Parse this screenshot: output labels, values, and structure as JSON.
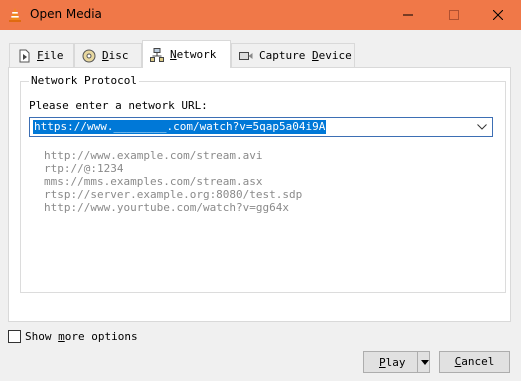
{
  "window": {
    "title": "Open Media",
    "icon": "vlc-cone-icon"
  },
  "tabs": [
    {
      "label": "File",
      "icon": "file-icon"
    },
    {
      "label": "Disc",
      "icon": "disc-icon"
    },
    {
      "label": "Network",
      "icon": "network-icon",
      "active": true
    },
    {
      "label": "Capture Device",
      "icon": "capture-device-icon"
    }
  ],
  "network": {
    "group_title": "Network Protocol",
    "url_label": "Please enter a network URL:",
    "url_value": "https://www.________.com/watch?v=5qap5a04i9A",
    "examples": [
      "http://www.example.com/stream.avi",
      "rtp://@:1234",
      "mms://mms.examples.com/stream.asx",
      "rtsp://server.example.org:8080/test.sdp",
      "http://www.yourtube.com/watch?v=gg64x"
    ]
  },
  "options": {
    "show_more_label": "Show more options",
    "checked": false
  },
  "buttons": {
    "play": "Play",
    "cancel": "Cancel"
  },
  "colors": {
    "titlebar": "#f07848",
    "selection": "#0078d7"
  }
}
